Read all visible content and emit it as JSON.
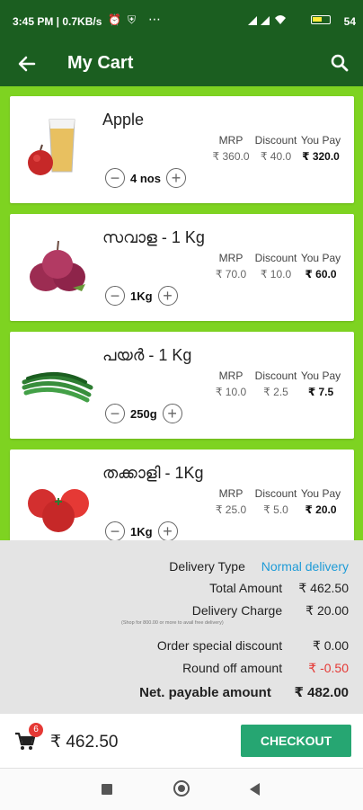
{
  "status": {
    "time_net": "3:45 PM | 0.7KB/s",
    "battery": "54"
  },
  "header": {
    "title": "My Cart"
  },
  "price_headers": {
    "mrp": "MRP",
    "discount": "Discount",
    "you_pay": "You Pay"
  },
  "items": [
    {
      "name": "Apple",
      "mrp": "₹ 360.0",
      "discount": "₹ 40.0",
      "you_pay": "₹ 320.0",
      "qty": "4 nos",
      "image": "apple-juice"
    },
    {
      "name": "സവാള - 1 Kg",
      "mrp": "₹ 70.0",
      "discount": "₹ 10.0",
      "you_pay": "₹ 60.0",
      "qty": "1Kg",
      "image": "onion"
    },
    {
      "name": "പയർ - 1 Kg",
      "mrp": "₹ 10.0",
      "discount": "₹ 2.5",
      "you_pay": "₹ 7.5",
      "qty": "250g",
      "image": "beans"
    },
    {
      "name": "തക്കാളി - 1Kg",
      "mrp": "₹ 25.0",
      "discount": "₹ 5.0",
      "you_pay": "₹ 20.0",
      "qty": "1Kg",
      "image": "tomato"
    }
  ],
  "summary": {
    "delivery_type_label": "Delivery Type",
    "delivery_type_value": "Normal delivery",
    "total_amount_label": "Total Amount",
    "total_amount_value": "₹ 462.50",
    "delivery_charge_label": "Delivery Charge",
    "delivery_charge_value": "₹ 20.00",
    "delivery_note": "(Shop for 800.00 or more to avail free delivery)",
    "order_discount_label": "Order special discount",
    "order_discount_value": "₹ 0.00",
    "round_off_label": "Round off amount",
    "round_off_value": "₹ -0.50",
    "net_payable_label": "Net. payable amount",
    "net_payable_value": "₹ 482.00"
  },
  "bottom": {
    "cart_count": "6",
    "total": "₹ 462.50",
    "checkout_label": "CHECKOUT"
  },
  "colors": {
    "primary": "#1b5e20",
    "accent_green": "#7ed321",
    "checkout": "#26a672",
    "link_blue": "#1e9bd7",
    "negative_red": "#e53935"
  }
}
